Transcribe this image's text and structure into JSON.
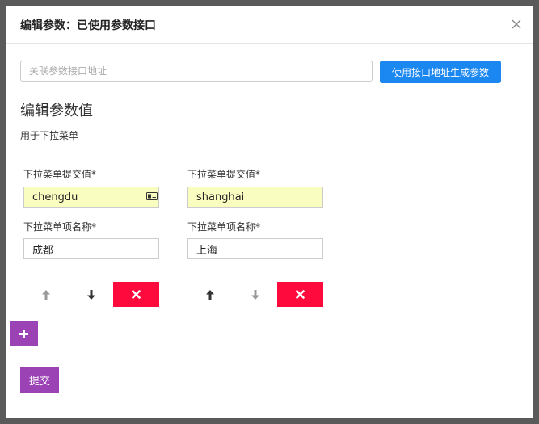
{
  "modal": {
    "title": "编辑参数：已使用参数接口",
    "close_icon": "close-icon"
  },
  "url_field": {
    "placeholder": "关联参数接口地址",
    "value": ""
  },
  "generate_button": {
    "label": "使用接口地址生成参数"
  },
  "section": {
    "title": "编辑参数值",
    "subtitle": "用于下拉菜单"
  },
  "options": [
    {
      "submit_label": "下拉菜单提交值*",
      "submit_value": "chengdu",
      "name_label": "下拉菜单项名称*",
      "name_value": "成都",
      "up_enabled": false,
      "down_enabled": true
    },
    {
      "submit_label": "下拉菜单提交值*",
      "submit_value": "shanghai",
      "name_label": "下拉菜单项名称*",
      "name_value": "上海",
      "up_enabled": true,
      "down_enabled": false
    }
  ],
  "add_button": {
    "icon": "plus-icon"
  },
  "submit_button": {
    "label": "提交"
  },
  "colors": {
    "primary_blue": "#1b87f0",
    "delete_red": "#ff0a3c",
    "purple": "#9b42b5",
    "autofill_yellow": "#fafdc0"
  }
}
